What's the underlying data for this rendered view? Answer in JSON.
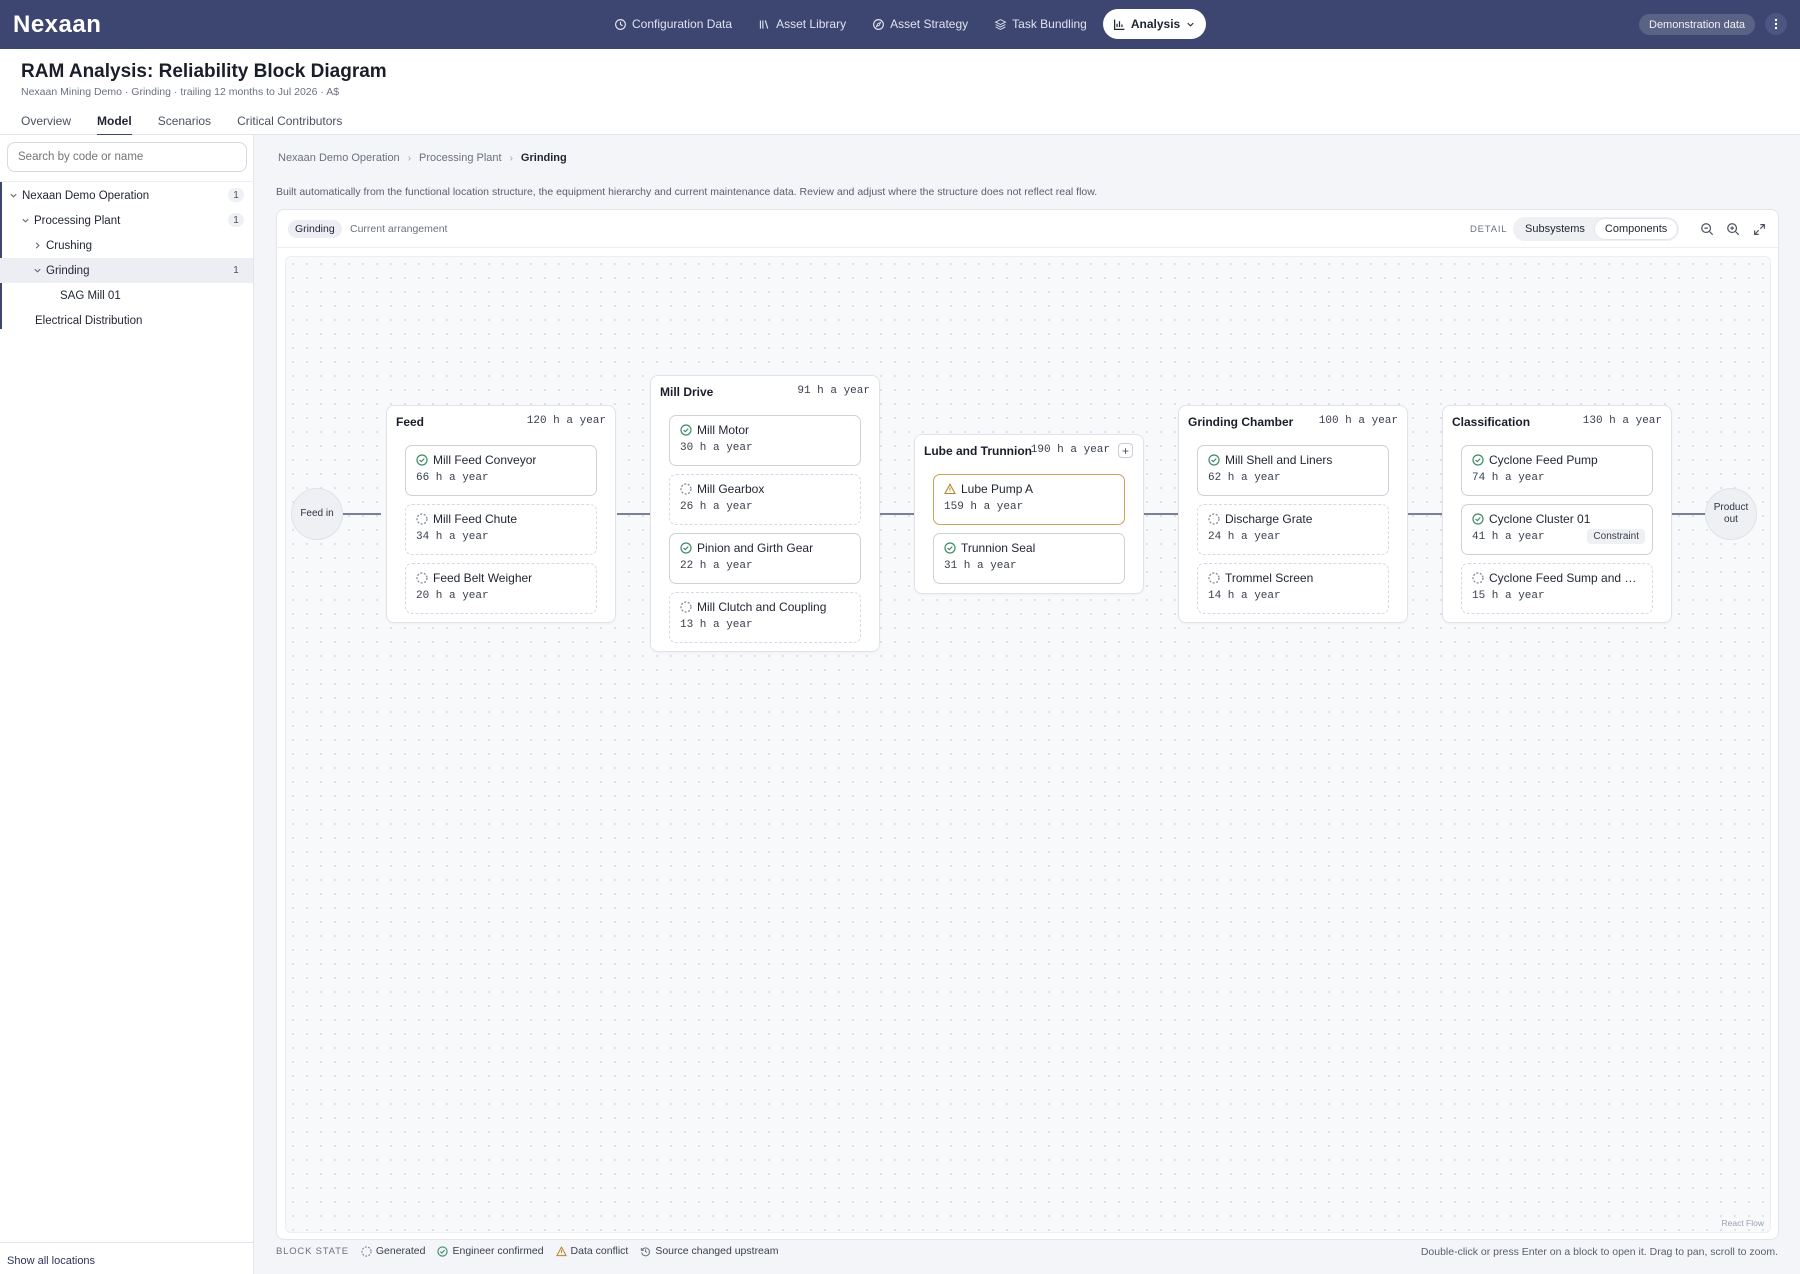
{
  "app": {
    "logo": "Nexaan",
    "nav": [
      {
        "label": "Configuration Data",
        "icon": "clock-icon"
      },
      {
        "label": "Asset Library",
        "icon": "library-icon"
      },
      {
        "label": "Asset Strategy",
        "icon": "compass-icon"
      },
      {
        "label": "Task Bundling",
        "icon": "layers-icon"
      },
      {
        "label": "Analysis",
        "icon": "bar-chart-icon",
        "active": true
      }
    ],
    "demo_badge": "Demonstration data"
  },
  "header": {
    "title": "RAM Analysis: Reliability Block Diagram",
    "subtitle": "Nexaan Mining Demo · Grinding · trailing 12 months to Jul 2026 · A$",
    "tabs": [
      "Overview",
      "Model",
      "Scenarios",
      "Critical Contributors"
    ],
    "active_tab": "Model"
  },
  "sidebar": {
    "search_placeholder": "Search by code or name",
    "tree": [
      {
        "label": "Nexaan Demo Operation",
        "count": "1",
        "expanded": true
      },
      {
        "label": "Processing Plant",
        "count": "1",
        "expanded": true
      },
      {
        "label": "Crushing",
        "expanded": false
      },
      {
        "label": "Grinding",
        "count": "1",
        "expanded": true,
        "selected": true
      },
      {
        "label": "SAG Mill 01"
      },
      {
        "label": "Electrical Distribution"
      }
    ],
    "show_all": "Show all locations"
  },
  "main": {
    "breadcrumb": [
      "Nexaan Demo Operation",
      "Processing Plant",
      "Grinding"
    ],
    "description": "Built automatically from the functional location structure, the equipment hierarchy and current maintenance data. Review and adjust where the structure does not reflect real flow.",
    "toolbar": {
      "chip": "Grinding",
      "arrangement": "Current arrangement",
      "detail_label": "DETAIL",
      "detail_options": [
        "Subsystems",
        "Components"
      ],
      "detail_selected": "Components"
    },
    "diagram": {
      "input": "Feed in",
      "output": "Product out",
      "groups": [
        {
          "title": "Feed",
          "hours": "120 h a year",
          "components": [
            {
              "name": "Mill Feed Conveyor",
              "hours": "66 h a year",
              "state": "confirmed"
            },
            {
              "name": "Mill Feed Chute",
              "hours": "34 h a year",
              "state": "generated"
            },
            {
              "name": "Feed Belt Weigher",
              "hours": "20 h a year",
              "state": "generated"
            }
          ]
        },
        {
          "title": "Mill Drive",
          "hours": "91 h a year",
          "components": [
            {
              "name": "Mill Motor",
              "hours": "30 h a year",
              "state": "confirmed"
            },
            {
              "name": "Mill Gearbox",
              "hours": "26 h a year",
              "state": "generated"
            },
            {
              "name": "Pinion and Girth Gear",
              "hours": "22 h a year",
              "state": "confirmed"
            },
            {
              "name": "Mill Clutch and Coupling",
              "hours": "13 h a year",
              "state": "generated"
            }
          ]
        },
        {
          "title": "Lube and Trunnion",
          "hours": "190 h a year",
          "components": [
            {
              "name": "Lube Pump A",
              "hours": "159 h a year",
              "state": "conflict"
            },
            {
              "name": "Trunnion Seal",
              "hours": "31 h a year",
              "state": "confirmed"
            }
          ]
        },
        {
          "title": "Grinding Chamber",
          "hours": "100 h a year",
          "components": [
            {
              "name": "Mill Shell and Liners",
              "hours": "62 h a year",
              "state": "confirmed"
            },
            {
              "name": "Discharge Grate",
              "hours": "24 h a year",
              "state": "generated"
            },
            {
              "name": "Trommel Screen",
              "hours": "14 h a year",
              "state": "generated"
            }
          ]
        },
        {
          "title": "Classification",
          "hours": "130 h a year",
          "components": [
            {
              "name": "Cyclone Feed Pump",
              "hours": "74 h a year",
              "state": "confirmed"
            },
            {
              "name": "Cyclone Cluster 01",
              "hours": "41 h a year",
              "state": "confirmed",
              "tag": "Constraint"
            },
            {
              "name": "Cyclone Feed Sump and …",
              "hours": "15 h a year",
              "state": "generated"
            }
          ]
        }
      ],
      "watermark": "React Flow"
    },
    "legend": {
      "label": "BLOCK STATE",
      "items": [
        "Generated",
        "Engineer confirmed",
        "Data conflict",
        "Source changed upstream"
      ]
    },
    "hint": "Double-click or press Enter on a block to open it. Drag to pan, scroll to zoom."
  },
  "colors": {
    "topbar": "#3d4670",
    "confirmed": "#3f8a6a",
    "conflict": "#c9a25a"
  }
}
